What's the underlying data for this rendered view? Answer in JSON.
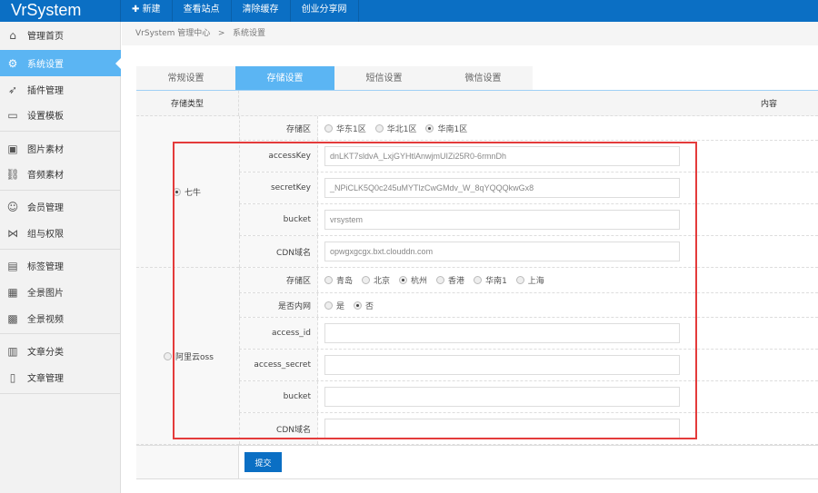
{
  "app": {
    "title": "VrSystem"
  },
  "topnav": [
    "新建",
    "查看站点",
    "清除缓存",
    "创业分享网"
  ],
  "sidebar": [
    {
      "label": "管理首页",
      "icon": "home-icon"
    },
    {
      "label": "系统设置",
      "icon": "gear-icon",
      "active": true
    },
    {
      "label": "插件管理",
      "icon": "send-icon"
    },
    {
      "label": "设置模板",
      "icon": "template-icon"
    },
    {
      "label": "图片素材",
      "icon": "image-icon"
    },
    {
      "label": "音频素材",
      "icon": "link-icon"
    },
    {
      "label": "会员管理",
      "icon": "users-icon"
    },
    {
      "label": "组与权限",
      "icon": "share-icon"
    },
    {
      "label": "标签管理",
      "icon": "tag-icon"
    },
    {
      "label": "全景图片",
      "icon": "panorama-icon"
    },
    {
      "label": "全景视频",
      "icon": "grid-icon"
    },
    {
      "label": "文章分类",
      "icon": "book-icon"
    },
    {
      "label": "文章管理",
      "icon": "file-icon"
    }
  ],
  "breadcrumb": {
    "root": "VrSystem 管理中心",
    "sep": ">",
    "current": "系统设置"
  },
  "tabs": [
    "常规设置",
    "存储设置",
    "短信设置",
    "微信设置"
  ],
  "table": {
    "col_type": "存储类型",
    "col_content": "内容"
  },
  "qiniu": {
    "label": "七牛",
    "region_label": "存储区",
    "regions": [
      "华东1区",
      "华北1区",
      "华南1区"
    ],
    "region_selected": 2,
    "fields": [
      {
        "label": "accessKey",
        "value": "dnLKT7sldvA_LxjGYHtlAnwjmUIZi25R0-6rmnDh"
      },
      {
        "label": "secretKey",
        "value": "_NPiCLK5Q0c245uMYTlzCwGMdv_W_8qYQQQkwGx8"
      },
      {
        "label": "bucket",
        "value": "vrsystem"
      },
      {
        "label": "CDN域名",
        "value": "opwgxgcgx.bxt.clouddn.com"
      }
    ]
  },
  "oss": {
    "label": "阿里云oss",
    "region_label": "存储区",
    "regions": [
      "青岛",
      "北京",
      "杭州",
      "香港",
      "华南1",
      "上海"
    ],
    "region_selected": 2,
    "intranet_label": "是否内网",
    "intranet_options": [
      "是",
      "否"
    ],
    "intranet_selected": 1,
    "fields": [
      {
        "label": "access_id",
        "value": ""
      },
      {
        "label": "access_secret",
        "value": ""
      },
      {
        "label": "bucket",
        "value": ""
      },
      {
        "label": "CDN域名",
        "value": ""
      }
    ]
  },
  "submit": "提交"
}
